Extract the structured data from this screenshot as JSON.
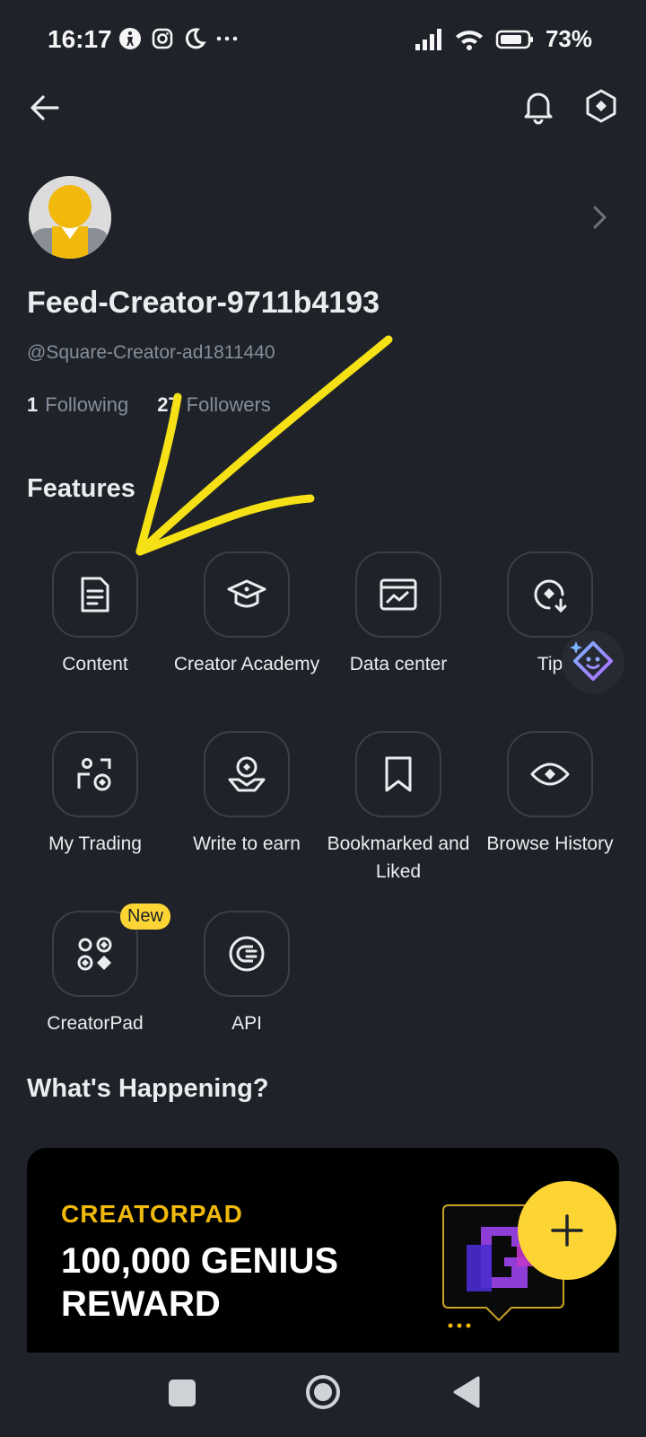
{
  "status_bar": {
    "time": "16:17",
    "battery": "73%"
  },
  "profile": {
    "username": "Feed-Creator-9711b4193",
    "handle": "@Square-Creator-ad1811440",
    "following_count": "1",
    "following_label": "Following",
    "followers_count": "27",
    "followers_label": "Followers"
  },
  "features": {
    "title": "Features",
    "items": [
      {
        "label": "Content",
        "icon": "document-icon"
      },
      {
        "label": "Creator Academy",
        "icon": "graduation-cap-icon"
      },
      {
        "label": "Data center",
        "icon": "chart-window-icon"
      },
      {
        "label": "Tip",
        "icon": "tip-icon"
      },
      {
        "label": "My Trading",
        "icon": "trading-icon"
      },
      {
        "label": "Write to earn",
        "icon": "write-earn-icon"
      },
      {
        "label": "Bookmarked and Liked",
        "icon": "bookmark-icon"
      },
      {
        "label": "Browse History",
        "icon": "eye-icon"
      },
      {
        "label": "CreatorPad",
        "icon": "creatorpad-icon",
        "badge": "New"
      },
      {
        "label": "API",
        "icon": "api-icon"
      }
    ]
  },
  "whats_happening": {
    "title": "What's Happening?",
    "banner_kicker": "CREATORPAD",
    "banner_headline": "100,000 GENIUS REWARD"
  },
  "colors": {
    "background": "#1f2329",
    "accent": "#fcd535",
    "muted_text": "#848e9c"
  }
}
